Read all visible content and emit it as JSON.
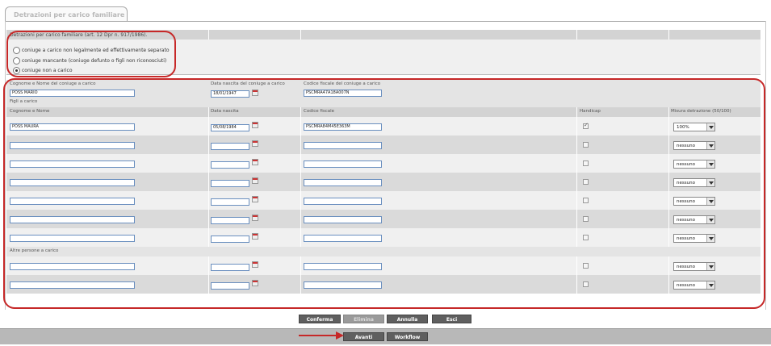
{
  "tab": {
    "label": "Detrazioni per carico familiare"
  },
  "spouse": {
    "title": "Detrazioni per carico familiare (art. 12 Dpr n. 917/1986).",
    "options": [
      {
        "label": "coniuge a carico non legalmente ed effettivamente separato",
        "checked": false
      },
      {
        "label": "coniuge mancante (coniuge defunto o figli non riconosciuti)",
        "checked": false
      },
      {
        "label": "coniuge non a carico",
        "checked": true
      }
    ]
  },
  "spouse_fields": {
    "name_label": "Cognome e Nome del coniuge a carico",
    "name_value": "POSS MARIO",
    "birth_label": "Data nascita del coniuge a carico",
    "birth_value": "18/01/1947",
    "cf_label": "Codice fiscale del coniuge a carico",
    "cf_value": "PSCMRA47A18A007N"
  },
  "children": {
    "section_label": "Figli a carico",
    "headers": {
      "name": "Cognome e Nome",
      "birth": "Data nascita",
      "cf": "Codice fiscale",
      "handicap": "Handicap",
      "perc": "Misura detrazione (50/100)"
    },
    "rows": [
      {
        "name": "POSS MAURA",
        "birth": "05/08/1984",
        "cf": "PSCMRA84M45E363M",
        "handicap": true,
        "perc": "100%"
      },
      {
        "name": "",
        "birth": "",
        "cf": "",
        "handicap": false,
        "perc": "nessuno"
      },
      {
        "name": "",
        "birth": "",
        "cf": "",
        "handicap": false,
        "perc": "nessuno"
      },
      {
        "name": "",
        "birth": "",
        "cf": "",
        "handicap": false,
        "perc": "nessuno"
      },
      {
        "name": "",
        "birth": "",
        "cf": "",
        "handicap": false,
        "perc": "nessuno"
      },
      {
        "name": "",
        "birth": "",
        "cf": "",
        "handicap": false,
        "perc": "nessuno"
      },
      {
        "name": "",
        "birth": "",
        "cf": "",
        "handicap": false,
        "perc": "nessuno"
      }
    ]
  },
  "others": {
    "section_label": "Altre persone a carico",
    "rows": [
      {
        "name": "",
        "birth": "",
        "cf": "",
        "handicap": false,
        "perc": "nessuno"
      },
      {
        "name": "",
        "birth": "",
        "cf": "",
        "handicap": false,
        "perc": "nessuno"
      }
    ]
  },
  "buttons": {
    "conferma": "Conferma",
    "elimina": "Elimina",
    "annulla": "Annulla",
    "esci": "Esci",
    "avanti": "Avanti",
    "workflow": "Workflow"
  },
  "colors": {
    "highlight": "#c62828",
    "button": "#5f5f5f",
    "input_border": "#6a8fbf"
  }
}
